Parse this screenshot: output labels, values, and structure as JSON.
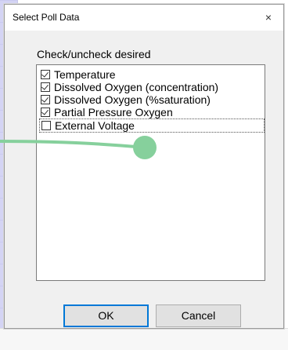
{
  "dialog": {
    "title": "Select Poll Data",
    "close_glyph": "×"
  },
  "instruction": "Check/uncheck desired",
  "items": [
    {
      "label": "Temperature",
      "checked": true
    },
    {
      "label": "Dissolved Oxygen (concentration)",
      "checked": true
    },
    {
      "label": "Dissolved Oxygen (%saturation)",
      "checked": true
    },
    {
      "label": "Partial Pressure Oxygen",
      "checked": true
    },
    {
      "label": "External Voltage",
      "checked": false
    }
  ],
  "buttons": {
    "ok_label": "OK",
    "cancel_label": "Cancel"
  },
  "colors": {
    "accent": "#0078d7",
    "connector": "#86d09c",
    "panel": "#d4d4f4"
  },
  "icons": {
    "close": "close-icon",
    "checkbox": "checkbox-icon"
  }
}
